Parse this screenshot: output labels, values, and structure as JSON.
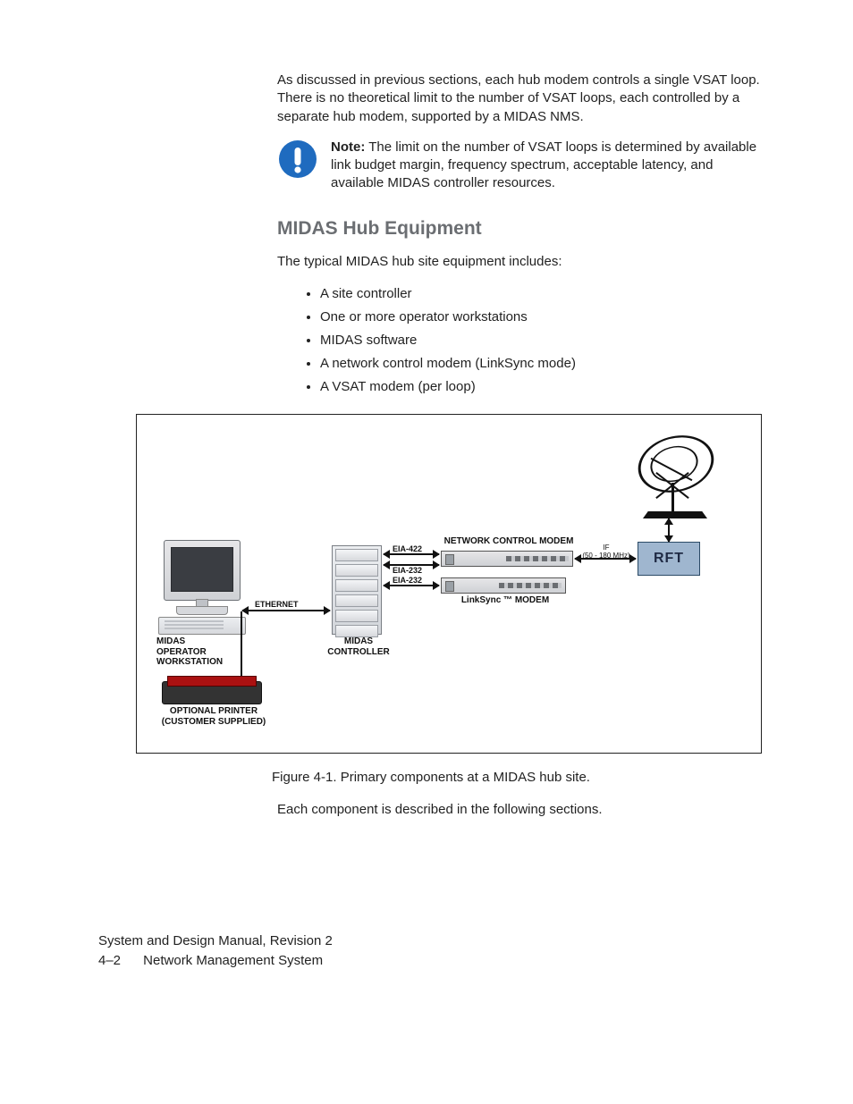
{
  "intro_para": "As discussed in previous sections, each hub modem controls a single VSAT loop. There is no theoretical limit to the number of VSAT loops, each controlled by a separate hub modem, supported by a MIDAS NMS.",
  "note": {
    "bold_label": "Note:",
    "text": "The limit on the number of VSAT loops is determined by available link budget margin, frequency spectrum, acceptable latency, and available MIDAS controller resources."
  },
  "heading": "MIDAS Hub Equipment",
  "list_intro": "The typical MIDAS hub site equipment includes:",
  "items": [
    "A site controller",
    "One or more operator workstations",
    "MIDAS software",
    "A network control modem (LinkSync mode)",
    "A VSAT modem (per loop)"
  ],
  "figure": {
    "workstation_label": "MIDAS\nOPERATOR\nWORKSTATION",
    "printer_label": "OPTIONAL PRINTER\n(CUSTOMER SUPPLIED)",
    "ethernet_label": "ETHERNET",
    "controller_label": "MIDAS\nCONTROLLER",
    "ncm_label": "NETWORK CONTROL MODEM",
    "linksync_label": "LinkSync ™ MODEM",
    "eia422_label": "EIA-422",
    "eia232a_label": "EIA-232",
    "eia232b_label": "EIA-232",
    "if_label": "IF\n(50 - 180 MHz)",
    "rft_label": "RFT"
  },
  "caption": "Figure 4-1. Primary components at a MIDAS hub site.",
  "after_caption": "Each component is described in the following sections.",
  "footer": {
    "line1": "System and Design Manual, Revision 2",
    "page_no": "4–2",
    "section": "Network Management System"
  }
}
